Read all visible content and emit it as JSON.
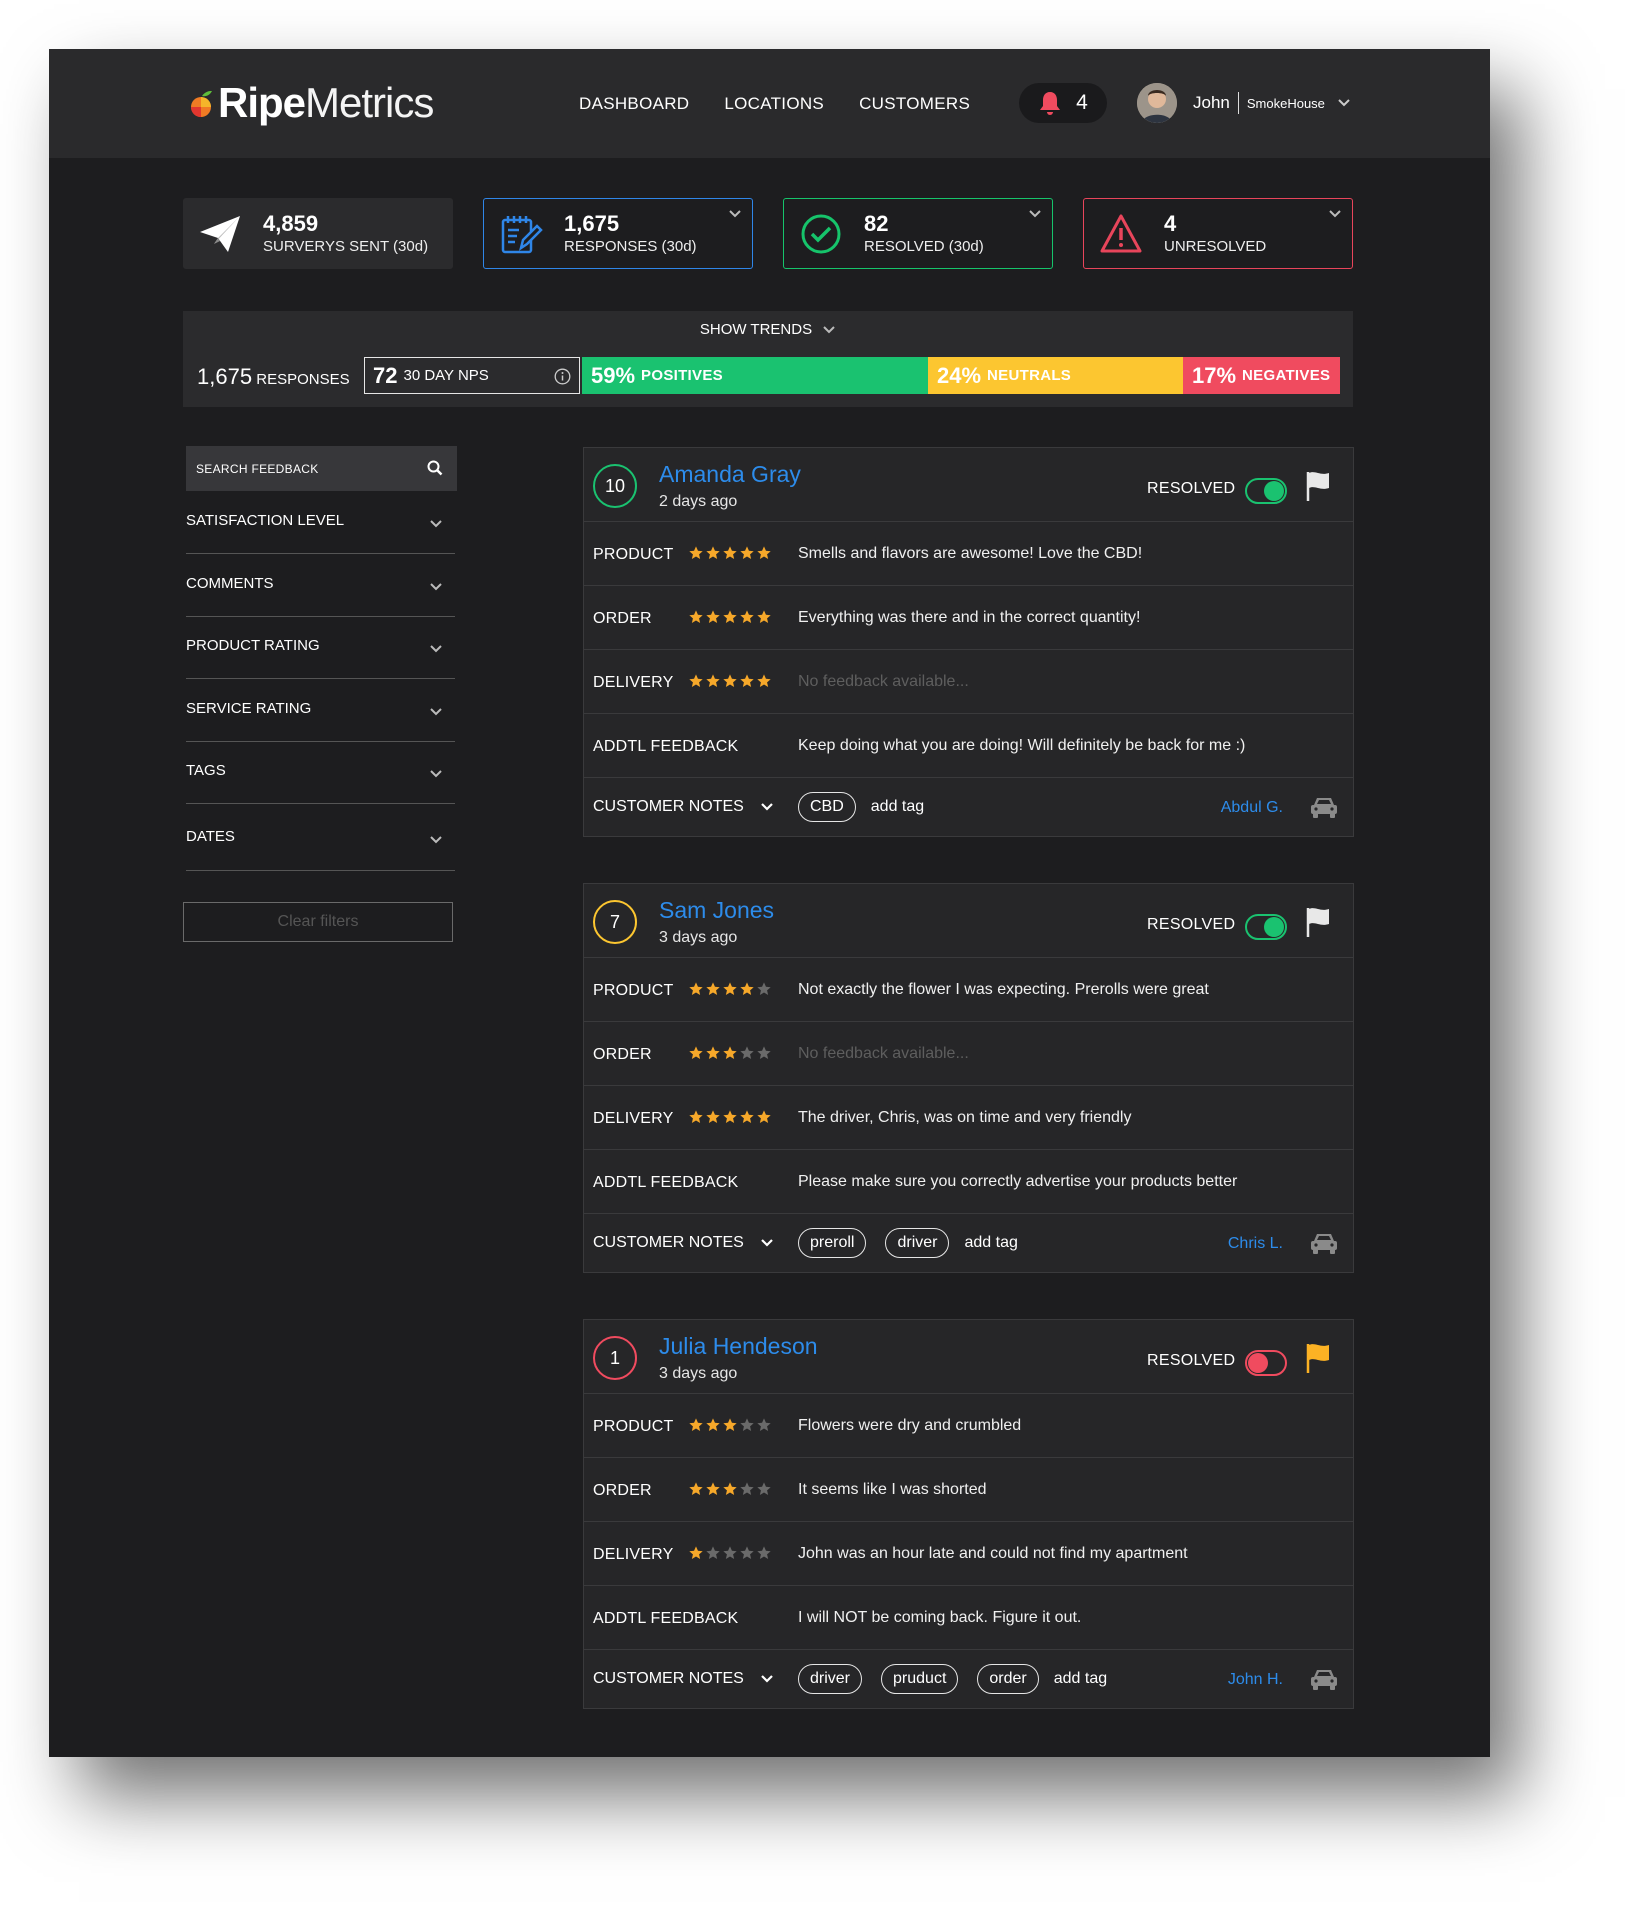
{
  "colors": {
    "accent_blue": "#2d8ceb",
    "green": "#1ac270",
    "yellow": "#fcc630",
    "red": "#f04b5f",
    "star": "#f6a82a"
  },
  "header": {
    "logo_bold": "Ripe",
    "logo_light": "Metrics",
    "nav": [
      "DASHBOARD",
      "LOCATIONS",
      "CUSTOMERS"
    ],
    "notification_count": "4",
    "user_name": "John",
    "user_org": "SmokeHouse"
  },
  "stats": {
    "sent": {
      "value": "4,859",
      "label": "SURVERYS SENT (30d)",
      "icon": "paper-plane-icon"
    },
    "responses": {
      "value": "1,675",
      "label": "RESPONSES (30d)",
      "icon": "notepad-icon"
    },
    "resolved": {
      "value": "82",
      "label": "RESOLVED (30d)",
      "icon": "check-circle-icon"
    },
    "unresolved": {
      "value": "4",
      "label": "UNRESOLVED",
      "icon": "warning-icon"
    }
  },
  "trends": {
    "toggle_label": "SHOW TRENDS",
    "responses_value": "1,675",
    "responses_label": "RESPONSES",
    "nps_value": "72",
    "nps_label": "30 DAY NPS",
    "positives": {
      "pct": "59%",
      "label": "POSITIVES"
    },
    "neutrals": {
      "pct": "24%",
      "label": "NEUTRALS"
    },
    "negatives": {
      "pct": "17%",
      "label": "NEGATIVES"
    }
  },
  "sidebar": {
    "search_placeholder": "SEARCH FEEDBACK",
    "filters": [
      "SATISFACTION LEVEL",
      "COMMENTS",
      "PRODUCT RATING",
      "SERVICE RATING",
      "TAGS",
      "DATES"
    ],
    "clear_label": "Clear filters"
  },
  "cards": [
    {
      "score": "10",
      "score_color": "#1ac270",
      "name": "Amanda Gray",
      "date": "2 days ago",
      "resolved_label": "RESOLVED",
      "resolved": true,
      "flag_color": "#e8e8e8",
      "rows": [
        {
          "label": "PRODUCT",
          "stars": 5,
          "text": "Smells and flavors are awesome! Love the CBD!"
        },
        {
          "label": "ORDER",
          "stars": 5,
          "text": "Everything was there and in the correct quantity!"
        },
        {
          "label": "DELIVERY",
          "stars": 5,
          "text": "No feedback available..."
        },
        {
          "label": "ADDTL FEEDBACK",
          "stars": 0,
          "text": "Keep doing what you are doing! Will definitely be back for me :)"
        }
      ],
      "notes_label": "CUSTOMER NOTES",
      "tags": [
        "CBD"
      ],
      "add_tag": "add tag",
      "agent": "Abdul G."
    },
    {
      "score": "7",
      "score_color": "#fcc630",
      "name": "Sam Jones",
      "date": "3 days ago",
      "resolved_label": "RESOLVED",
      "resolved": true,
      "flag_color": "#e8e8e8",
      "rows": [
        {
          "label": "PRODUCT",
          "stars": 4,
          "text": "Not exactly the flower I was expecting. Prerolls were great"
        },
        {
          "label": "ORDER",
          "stars": 3,
          "text": "No feedback available..."
        },
        {
          "label": "DELIVERY",
          "stars": 5,
          "text": "The driver, Chris, was on time and very friendly"
        },
        {
          "label": "ADDTL FEEDBACK",
          "stars": 0,
          "text": "Please make sure you correctly advertise your products better"
        }
      ],
      "notes_label": "CUSTOMER NOTES",
      "tags": [
        "preroll",
        "driver"
      ],
      "add_tag": "add tag",
      "agent": "Chris L."
    },
    {
      "score": "1",
      "score_color": "#f04b5f",
      "name": "Julia Hendeson",
      "date": "3 days ago",
      "resolved_label": "RESOLVED",
      "resolved": false,
      "flag_color": "#fcb224",
      "rows": [
        {
          "label": "PRODUCT",
          "stars": 3,
          "text": "Flowers were dry and crumbled"
        },
        {
          "label": "ORDER",
          "stars": 3,
          "text": "It seems like I was shorted"
        },
        {
          "label": "DELIVERY",
          "stars": 1,
          "text": "John was an hour late and could not find my apartment"
        },
        {
          "label": "ADDTL FEEDBACK",
          "stars": 0,
          "text": "I will NOT be coming back.  Figure it out."
        }
      ],
      "notes_label": "CUSTOMER NOTES",
      "tags": [
        "driver",
        "pruduct",
        "order"
      ],
      "add_tag": "add tag",
      "agent": "John H."
    }
  ]
}
